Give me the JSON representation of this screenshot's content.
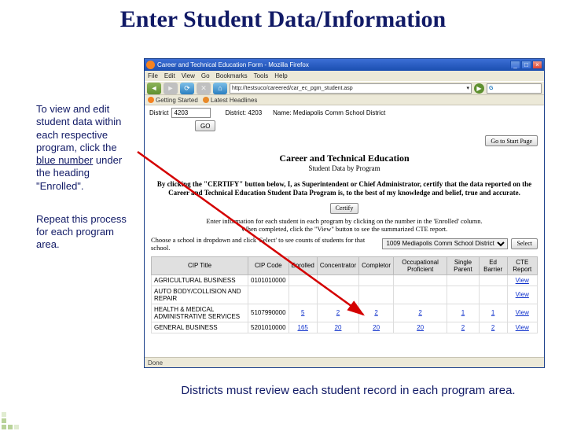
{
  "slide": {
    "title": "Enter Student Data/Information",
    "para1_a": "To view and edit student data within each respective program, click the ",
    "para1_b": "blue number",
    "para1_c": " under the heading \"Enrolled\".",
    "para2": "Repeat this process for each program area.",
    "bottom_note": "Districts must review each student record in each program area."
  },
  "browser": {
    "window_title": "Career and Technical Education Form - Mozilla Firefox",
    "menus": [
      "File",
      "Edit",
      "View",
      "Go",
      "Bookmarks",
      "Tools",
      "Help"
    ],
    "url": "http://testsuco/careered/car_ec_pgm_student.asp",
    "go": "Go",
    "search_engine": "G",
    "bookmarks": [
      "Getting Started",
      "Latest Headlines"
    ],
    "status": "Done",
    "win_min": "_",
    "win_max": "□",
    "win_close": "×",
    "nav_back": "◄",
    "nav_fwd": "►",
    "nav_reload": "⟳",
    "nav_stop": "✕",
    "nav_home": "⌂",
    "nav_go_icon": "▶",
    "tri": "▾"
  },
  "page": {
    "district_label": "District",
    "district_value": "4203",
    "go_btn": "GO",
    "district_num": "District: 4203",
    "district_name": "Name: Mediapolis Comm School District",
    "start_btn": "Go to Start Page",
    "title": "Career and Technical Education",
    "subtitle": "Student Data by Program",
    "cert_text": "By clicking the \"CERTIFY\" button below, I, as Superintendent or Chief Administrator, certify that the data reported on the Career and Technical Education Student Data Program is, to the best of my knowledge and belief, true and accurate.",
    "certify_btn": "Certify",
    "instr1": "Enter information for each student in each program by clicking on the number in the 'Enrolled' column.",
    "instr2": "When completed, click the \"View\" button to see the summarized CTE report.",
    "sel_label": "Choose a school in dropdown and click 'Select' to see counts of students for that school.",
    "sel_option": "1009 Mediapolis Comm School District",
    "sel_btn": "Select",
    "headers": [
      "CIP Title",
      "CIP Code",
      "Enrolled",
      "Concentrator",
      "Completor",
      "Occupational Proficient",
      "Single Parent",
      "Ed Barrier",
      "CTE Report"
    ],
    "rows": [
      {
        "title": "AGRICULTURAL BUSINESS",
        "cip": "0101010000",
        "enrolled": "",
        "conc": "",
        "comp": "",
        "occ": "",
        "single": "",
        "ed": "",
        "report": "View"
      },
      {
        "title": "AUTO BODY/COLLISION AND REPAIR",
        "cip": "",
        "enrolled": "",
        "conc": "",
        "comp": "",
        "occ": "",
        "single": "",
        "ed": "",
        "report": "View"
      },
      {
        "title": "HEALTH & MEDICAL ADMINISTRATIVE SERVICES",
        "cip": "5107990000",
        "enrolled": "5",
        "conc": "2",
        "comp": "2",
        "occ": "2",
        "single": "1",
        "ed": "1",
        "report": "View"
      },
      {
        "title": "GENERAL BUSINESS",
        "cip": "5201010000",
        "enrolled": "165",
        "conc": "20",
        "comp": "20",
        "occ": "20",
        "single": "2",
        "ed": "2",
        "report": "View"
      }
    ]
  }
}
